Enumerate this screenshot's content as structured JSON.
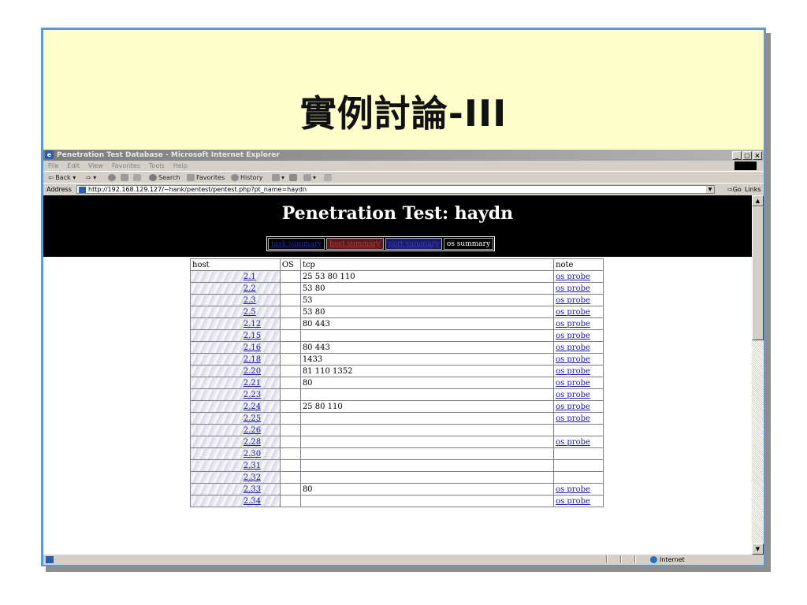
{
  "slide": {
    "title": "實例討論-III"
  },
  "browser": {
    "window_title": "Penetration Test Database - Microsoft Internet Explorer",
    "menu": [
      "File",
      "Edit",
      "View",
      "Favorites",
      "Tools",
      "Help"
    ],
    "toolbar": {
      "back": "Back",
      "search": "Search",
      "favorites": "Favorites",
      "history": "History"
    },
    "address_label": "Address",
    "address_value": "http://192.168.129.127/~hank/pentest/pentest.php?pt_name=haydn",
    "go_label": "Go",
    "links_label": "Links",
    "status_zone": "Internet"
  },
  "page": {
    "heading": "Penetration Test: haydn",
    "tabs": [
      "task summary",
      "host summary",
      "port summary",
      "os summary"
    ],
    "columns": [
      "host",
      "OS",
      "tcp",
      "note"
    ],
    "rows": [
      {
        "host": "2.1",
        "os": "",
        "tcp": "25 53 80 110",
        "note": "os probe"
      },
      {
        "host": "2.2",
        "os": "",
        "tcp": "53 80",
        "note": "os probe"
      },
      {
        "host": "2.3",
        "os": "",
        "tcp": "53",
        "note": "os probe"
      },
      {
        "host": "2.5",
        "os": "",
        "tcp": "53 80",
        "note": "os probe"
      },
      {
        "host": "2.12",
        "os": "",
        "tcp": "80 443",
        "note": "os probe"
      },
      {
        "host": "2.15",
        "os": "",
        "tcp": "",
        "note": "os probe"
      },
      {
        "host": "2.16",
        "os": "",
        "tcp": "80 443",
        "note": "os probe"
      },
      {
        "host": "2.18",
        "os": "",
        "tcp": "1433",
        "note": "os probe"
      },
      {
        "host": "2.20",
        "os": "",
        "tcp": "81 110 1352",
        "note": "os probe"
      },
      {
        "host": "2.21",
        "os": "",
        "tcp": "80",
        "note": "os probe"
      },
      {
        "host": "2.23",
        "os": "",
        "tcp": "",
        "note": "os probe"
      },
      {
        "host": "2.24",
        "os": "",
        "tcp": "25 80 110",
        "note": "os probe"
      },
      {
        "host": "2.25",
        "os": "",
        "tcp": "",
        "note": "os probe"
      },
      {
        "host": "2.26",
        "os": "",
        "tcp": "",
        "note": ""
      },
      {
        "host": "2.28",
        "os": "",
        "tcp": "",
        "note": "os probe"
      },
      {
        "host": "2.30",
        "os": "",
        "tcp": "",
        "note": ""
      },
      {
        "host": "2.31",
        "os": "",
        "tcp": "",
        "note": ""
      },
      {
        "host": "2.32",
        "os": "",
        "tcp": "",
        "note": ""
      },
      {
        "host": "2.33",
        "os": "",
        "tcp": "80",
        "note": "os probe"
      },
      {
        "host": "2.34",
        "os": "",
        "tcp": "",
        "note": "os probe"
      }
    ]
  }
}
